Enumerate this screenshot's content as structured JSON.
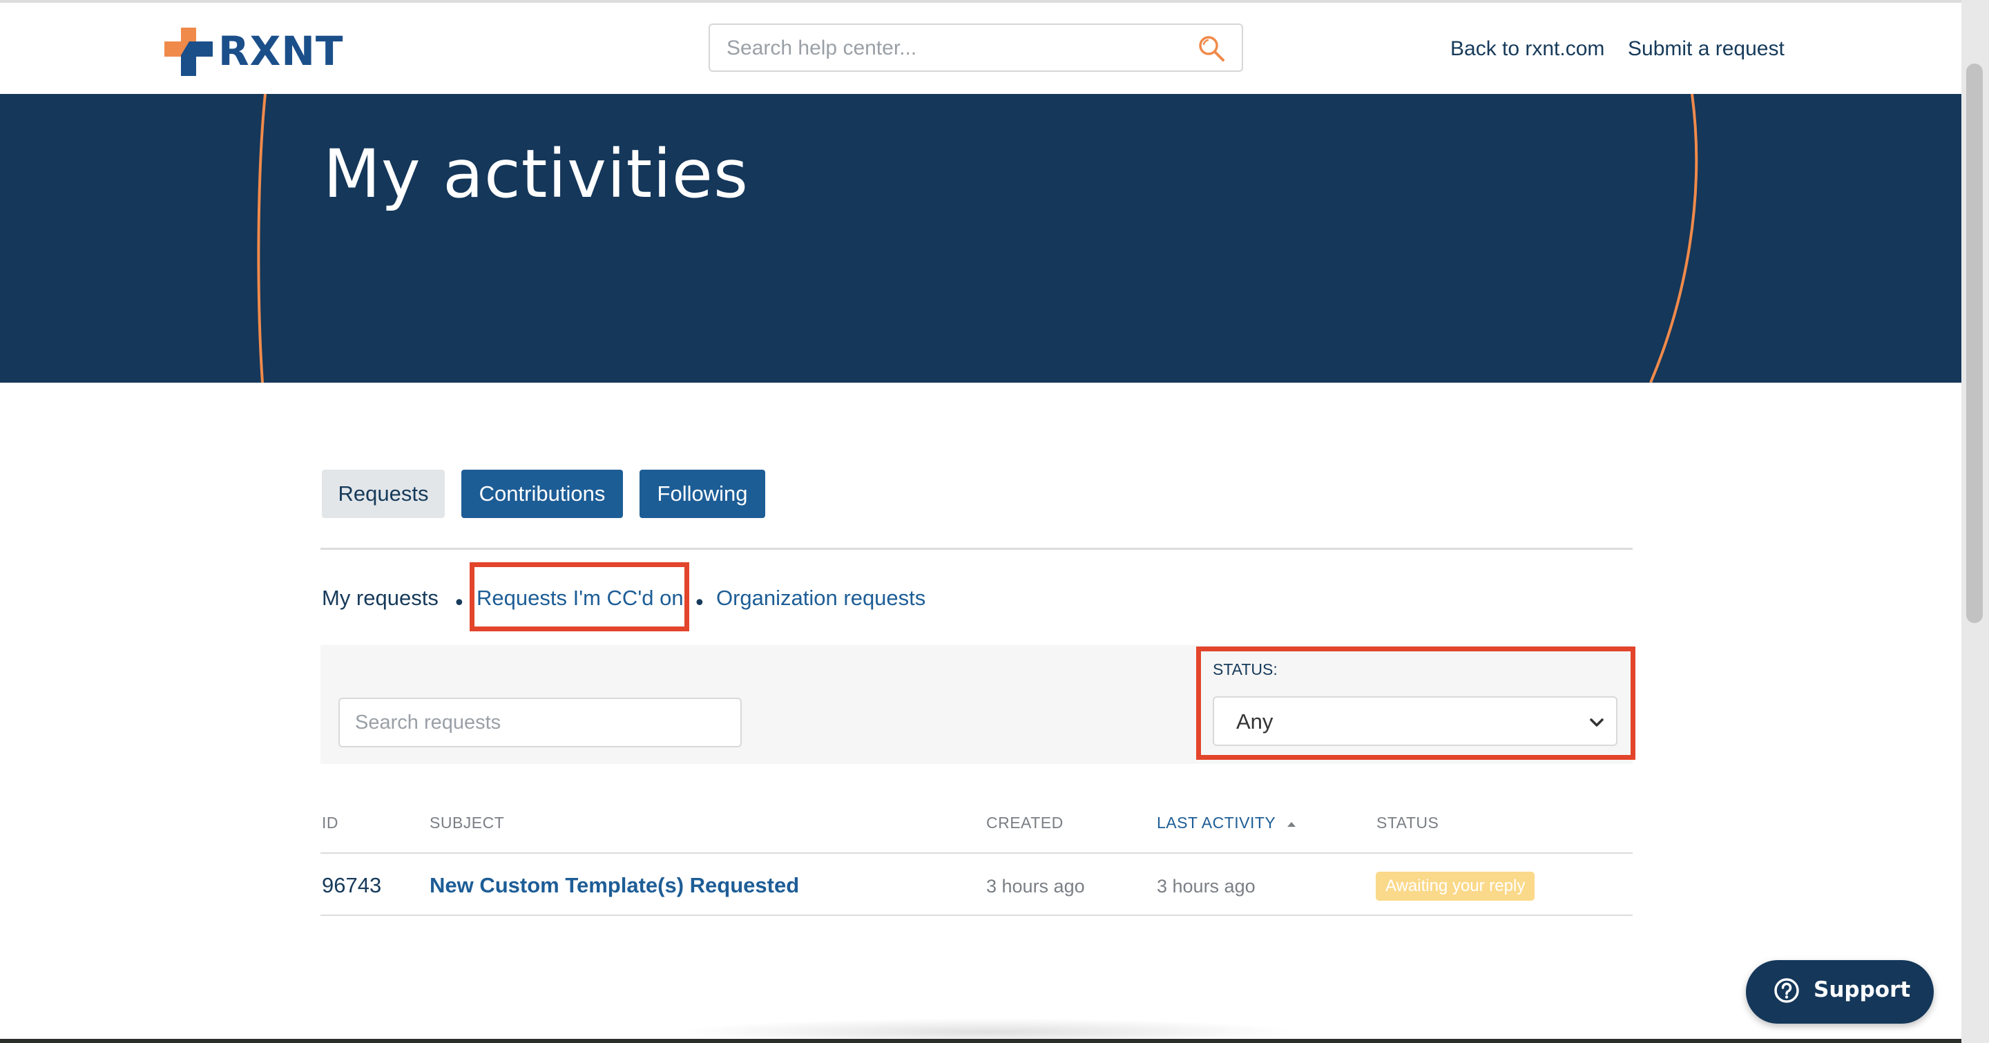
{
  "header": {
    "logo_text": "RXNT",
    "search_placeholder": "Search help center...",
    "links": [
      "Back to rxnt.com",
      "Submit a request"
    ]
  },
  "hero": {
    "title": "My activities"
  },
  "tabs": [
    {
      "label": "Requests",
      "active": true
    },
    {
      "label": "Contributions",
      "active": false
    },
    {
      "label": "Following",
      "active": false
    }
  ],
  "subnav": {
    "current": "My requests",
    "links": [
      "Requests I'm CC'd on",
      "Organization requests"
    ]
  },
  "filters": {
    "search_placeholder": "Search requests",
    "status_label": "STATUS:",
    "status_value": "Any"
  },
  "table": {
    "headers": [
      "ID",
      "SUBJECT",
      "CREATED",
      "LAST ACTIVITY",
      "STATUS"
    ],
    "rows": [
      {
        "id": "96743",
        "subject": "New Custom Template(s) Requested",
        "created": "3 hours ago",
        "last_activity": "3 hours ago",
        "status": "Awaiting your reply"
      }
    ]
  },
  "support": {
    "label": "Support"
  },
  "colors": {
    "navy": "#14375a",
    "blue": "#1d5d96",
    "orange": "#f08a4b",
    "highlight": "#e2452b",
    "badge": "#fbd98a"
  }
}
